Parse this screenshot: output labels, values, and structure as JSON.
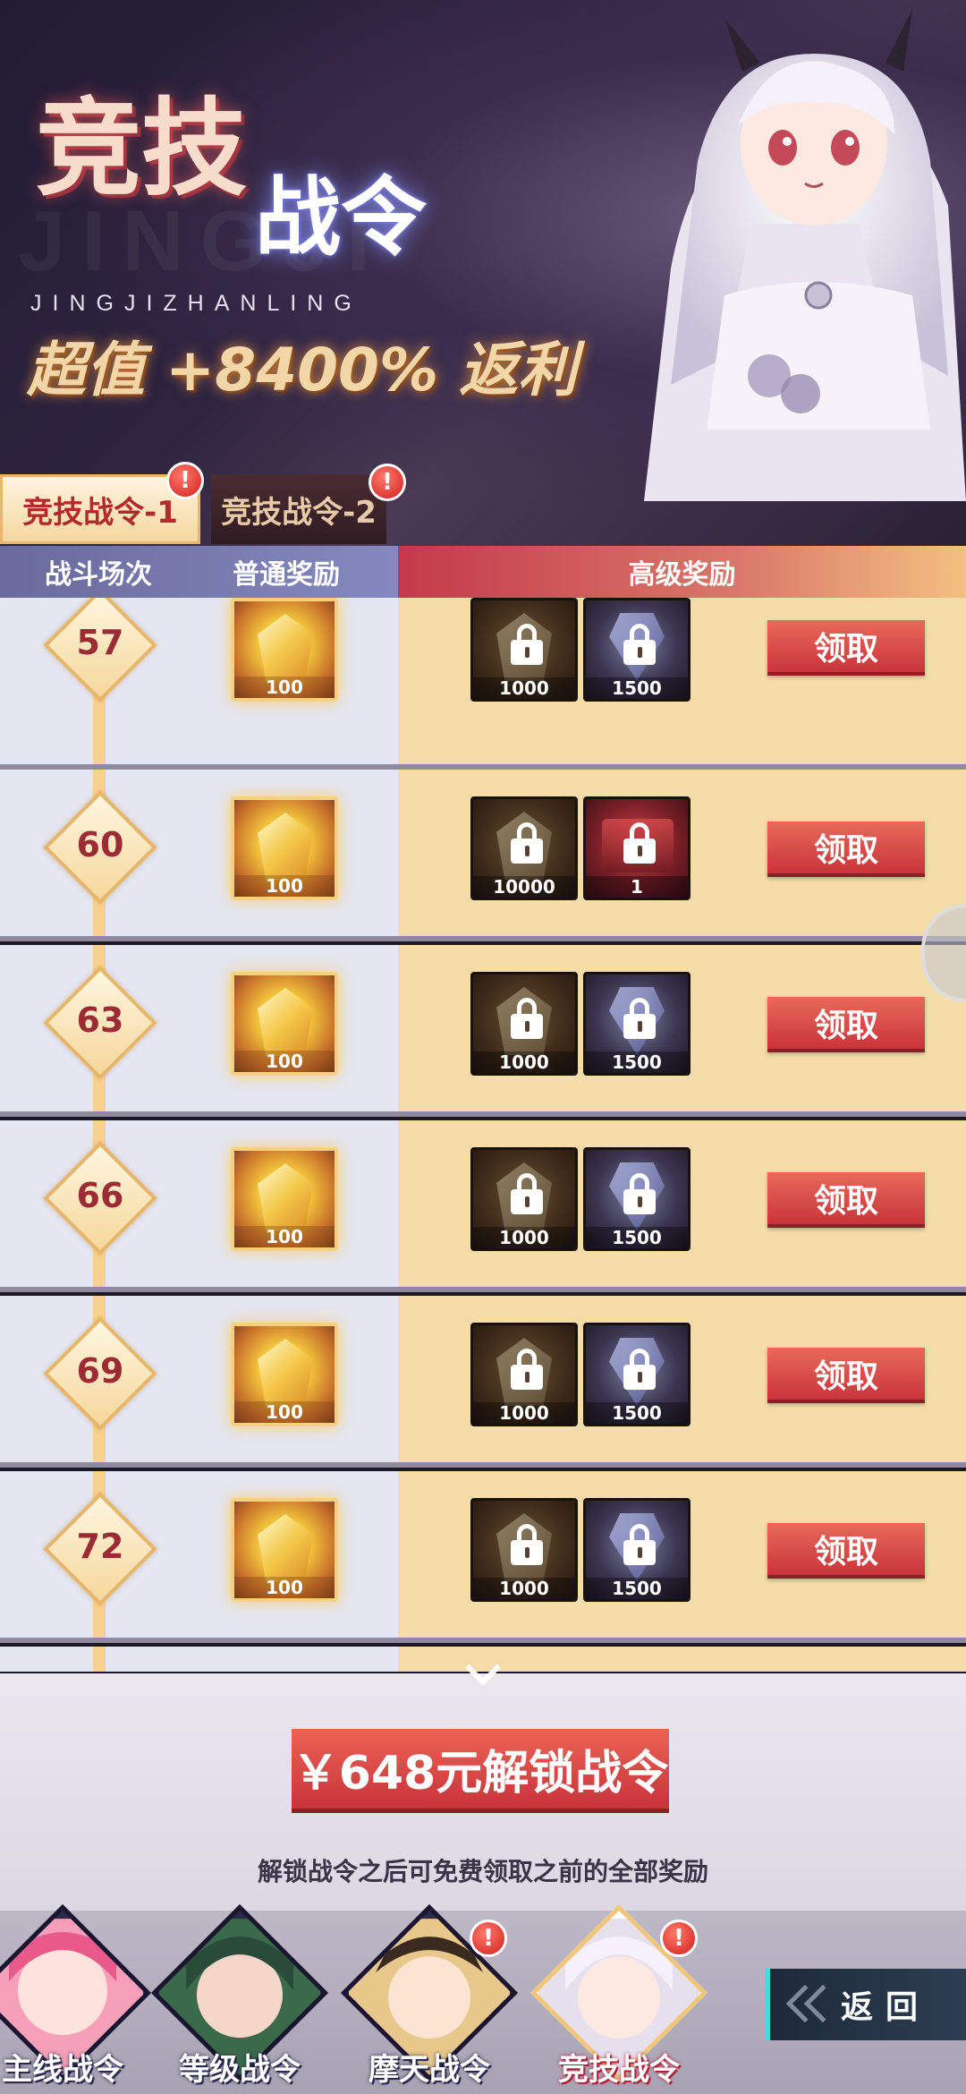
{
  "banner": {
    "title_main": "竞技",
    "title_sub": "战令",
    "pinyin": "JINGJIZHANLING",
    "promo": "超值 +8400% 返利"
  },
  "tabs": [
    {
      "label": "竞技战令-1",
      "active": true,
      "alert": "!"
    },
    {
      "label": "竞技战令-2",
      "active": false,
      "alert": "!"
    }
  ],
  "columns": {
    "battle": "战斗场次",
    "normal": "普通奖励",
    "advanced": "高级奖励"
  },
  "rows": [
    {
      "level": "57",
      "normal_qty": "100",
      "adv1_qty": "1000",
      "adv2_qty": "1500",
      "adv2_type": "gem",
      "claim": "领取"
    },
    {
      "level": "60",
      "normal_qty": "100",
      "adv1_qty": "10000",
      "adv2_qty": "1",
      "adv2_type": "chest",
      "claim": "领取"
    },
    {
      "level": "63",
      "normal_qty": "100",
      "adv1_qty": "1000",
      "adv2_qty": "1500",
      "adv2_type": "gem",
      "claim": "领取"
    },
    {
      "level": "66",
      "normal_qty": "100",
      "adv1_qty": "1000",
      "adv2_qty": "1500",
      "adv2_type": "gem",
      "claim": "领取"
    },
    {
      "level": "69",
      "normal_qty": "100",
      "adv1_qty": "1000",
      "adv2_qty": "1500",
      "adv2_type": "gem",
      "claim": "领取"
    },
    {
      "level": "72",
      "normal_qty": "100",
      "adv1_qty": "1000",
      "adv2_qty": "1500",
      "adv2_type": "gem",
      "claim": "领取"
    }
  ],
  "unlock": {
    "button": "￥648元解锁战令",
    "note": "解锁战令之后可免费领取之前的全部奖励"
  },
  "bottom_nav": [
    {
      "label": "主线战令",
      "alert": ""
    },
    {
      "label": "等级战令",
      "alert": ""
    },
    {
      "label": "摩天战令",
      "alert": "!"
    },
    {
      "label": "竞技战令",
      "alert": "!",
      "active": true
    }
  ],
  "back_label": "返回"
}
